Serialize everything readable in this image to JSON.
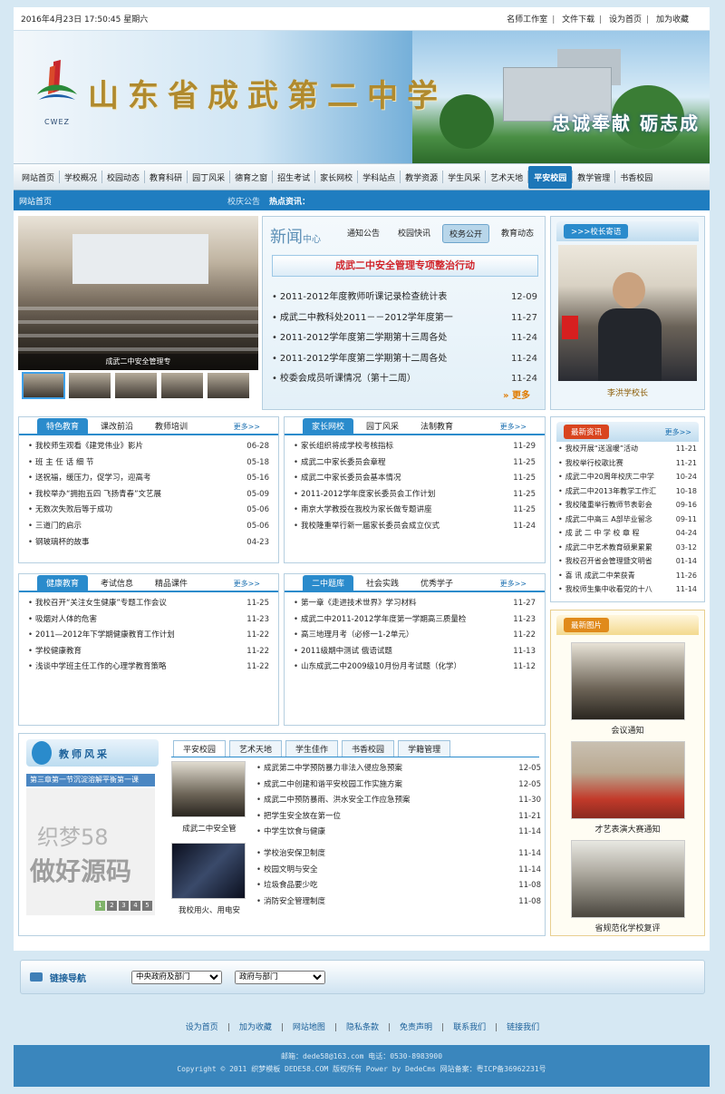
{
  "topbar": {
    "datetime": "2016年4月23日  17:50:45 星期六",
    "links": [
      "名师工作室",
      "文件下载",
      "设为首页",
      "加为收藏"
    ]
  },
  "banner": {
    "school_name": "山东省成武第二中学",
    "abbrev": "CWEZ",
    "slogan": "忠诚奉献  砺志成"
  },
  "nav": {
    "items": [
      "网站首页",
      "学校概况",
      "校园动态",
      "教育科研",
      "园丁风采",
      "德育之窗",
      "招生考试",
      "家长网校",
      "学科站点",
      "教学资源",
      "学生风采",
      "艺术天地",
      "平安校园",
      "教学管理",
      "书香校园"
    ],
    "active_index": 12
  },
  "subbar": {
    "home": "网站首页",
    "notice": "校庆公告",
    "hot": "热点资讯："
  },
  "slideshow": {
    "caption": "成武二中安全管理专"
  },
  "news": {
    "title_main": "新闻",
    "title_sub": "中心",
    "tabs": [
      "通知公告",
      "校园快讯",
      "校务公开",
      "教育动态"
    ],
    "active_tab": 2,
    "headline": "成武二中安全管理专项整治行动",
    "items": [
      {
        "title": "2011-2012年度教师听课记录检查统计表",
        "date": "12-09"
      },
      {
        "title": "成武二中教科处2011－－2012学年度第一",
        "date": "11-27"
      },
      {
        "title": "2011-2012学年度第二学期第十三周各处",
        "date": "11-24"
      },
      {
        "title": "2011-2012学年度第二学期第十二周各处",
        "date": "11-24"
      },
      {
        "title": "校委会成员听课情况（第十二周）",
        "date": "11-24"
      }
    ],
    "more": "更多"
  },
  "principal": {
    "title": ">>>校长寄语",
    "name": "李洪学校长"
  },
  "box1": {
    "tabs": [
      "特色教育",
      "课改前沿",
      "教师培训"
    ],
    "more": "更多>>",
    "items": [
      {
        "title": "我校师生观看《建党伟业》影片",
        "date": "06-28"
      },
      {
        "title": "班 主 任 话 细 节",
        "date": "05-18"
      },
      {
        "title": "送祝福，缓压力，促学习，迎高考",
        "date": "05-16"
      },
      {
        "title": "我校举办“拥抱五四 飞扬青春”文艺展",
        "date": "05-09"
      },
      {
        "title": "无数次失败后等于成功",
        "date": "05-06"
      },
      {
        "title": "三道门的启示",
        "date": "05-06"
      },
      {
        "title": "钢玻璃杯的故事",
        "date": "04-23"
      }
    ]
  },
  "box2": {
    "tabs": [
      "家长网校",
      "园丁风采",
      "法制教育"
    ],
    "more": "更多>>",
    "items": [
      {
        "title": "家长组织将成学校考核指标",
        "date": "11-29"
      },
      {
        "title": "成武二中家长委员会章程",
        "date": "11-25"
      },
      {
        "title": "成武二中家长委员会基本情况",
        "date": "11-25"
      },
      {
        "title": "2011-2012学年度家长委员会工作计划",
        "date": "11-25"
      },
      {
        "title": "南京大学教授在我校为家长做专题讲座",
        "date": "11-25"
      },
      {
        "title": "我校隆重举行新一届家长委员会成立仪式",
        "date": "11-24"
      }
    ]
  },
  "latest": {
    "title": "最新资讯",
    "more": "更多>>",
    "items": [
      {
        "title": "我校开展“送温暖”活动",
        "date": "11-21"
      },
      {
        "title": "我校举行校歌比赛",
        "date": "11-21"
      },
      {
        "title": "成武二中20周年校庆二中学",
        "date": "10-24"
      },
      {
        "title": "成武二中2013年教学工作汇",
        "date": "10-18"
      },
      {
        "title": "我校隆重举行教师节表彰会",
        "date": "09-16"
      },
      {
        "title": "成武二中高三 A部毕业留念",
        "date": "09-11"
      },
      {
        "title": "成 武 二 中 学 校 章 程",
        "date": "04-24"
      },
      {
        "title": "成武二中艺术教育硕果累累",
        "date": "03-12"
      },
      {
        "title": "我校召开省会管理暨文明省",
        "date": "01-14"
      },
      {
        "title": "喜 讯 成武二中荣获青",
        "date": "11-26"
      },
      {
        "title": "我校师生集中收看党的十八",
        "date": "11-14"
      }
    ]
  },
  "box3": {
    "tabs": [
      "健康教育",
      "考试信息",
      "精品课件"
    ],
    "more": "更多>>",
    "items": [
      {
        "title": "我校召开“关注女生健康”专题工作会议",
        "date": "11-25"
      },
      {
        "title": "吸烟对人体的危害",
        "date": "11-23"
      },
      {
        "title": "2011—2012年下学期健康教育工作计划",
        "date": "11-22"
      },
      {
        "title": "学校健康教育",
        "date": "11-22"
      },
      {
        "title": "浅谈中学班主任工作的心理学教育策略",
        "date": "11-22"
      }
    ]
  },
  "box4": {
    "tabs": [
      "二中题库",
      "社会实践",
      "优秀学子"
    ],
    "more": "更多>>",
    "items": [
      {
        "title": "第一章《走进技术世界》学习材料",
        "date": "11-27"
      },
      {
        "title": "成武二中2011-2012学年度第一学期高三质量检",
        "date": "11-23"
      },
      {
        "title": "高三地理月考（必修一1-2单元）",
        "date": "11-22"
      },
      {
        "title": "2011级期中测试 俄语试题",
        "date": "11-13"
      },
      {
        "title": "山东成武二中2009级10月份月考试题（化学）",
        "date": "11-12"
      }
    ]
  },
  "photos": {
    "title": "最新图片",
    "items": [
      "会议通知",
      "才艺表演大赛通知",
      "省规范化学校复评"
    ]
  },
  "teacher": {
    "title": "教师风采",
    "marquee": "第三章第一节沉淀溶解平衡第一课",
    "watermark1": "织梦58",
    "watermark2": "做好源码",
    "pages": [
      "1",
      "2",
      "3",
      "4",
      "5"
    ]
  },
  "safe": {
    "tabs": [
      "平安校园",
      "艺术天地",
      "学生佳作",
      "书香校园",
      "学籍管理"
    ],
    "thumbs": [
      "成武二中安全管",
      "我校用火、用电安"
    ],
    "items_a": [
      {
        "title": "成武第二中学预防暴力非法入侵应急预案",
        "date": "12-05"
      },
      {
        "title": "成武二中创建和谐平安校园工作实施方案",
        "date": "12-05"
      },
      {
        "title": "成武二中预防暴雨、洪水安全工作应急预案",
        "date": "11-30"
      },
      {
        "title": "把学生安全放在第一位",
        "date": "11-21"
      },
      {
        "title": "中学生饮食与健康",
        "date": "11-14"
      }
    ],
    "items_b": [
      {
        "title": "学校治安保卫制度",
        "date": "11-14"
      },
      {
        "title": "校园文明与安全",
        "date": "11-14"
      },
      {
        "title": "垃圾食品要少吃",
        "date": "11-08"
      },
      {
        "title": "消防安全管理制度",
        "date": "11-08"
      }
    ]
  },
  "links": {
    "title": "链接导航",
    "select1": "中央政府及部门",
    "select2": "政府与部门"
  },
  "footer": {
    "links": [
      "设为首页",
      "加为收藏",
      "网站地图",
      "隐私条款",
      "免责声明",
      "联系我们",
      "链接我们"
    ],
    "line1": "邮箱：dede58@163.com 电话：0530-8983900",
    "line2": "Copyright © 2011 织梦模板 DEDE58.COM 版权所有 Power by DedeCms 网站备案：粤ICP备36962231号"
  }
}
